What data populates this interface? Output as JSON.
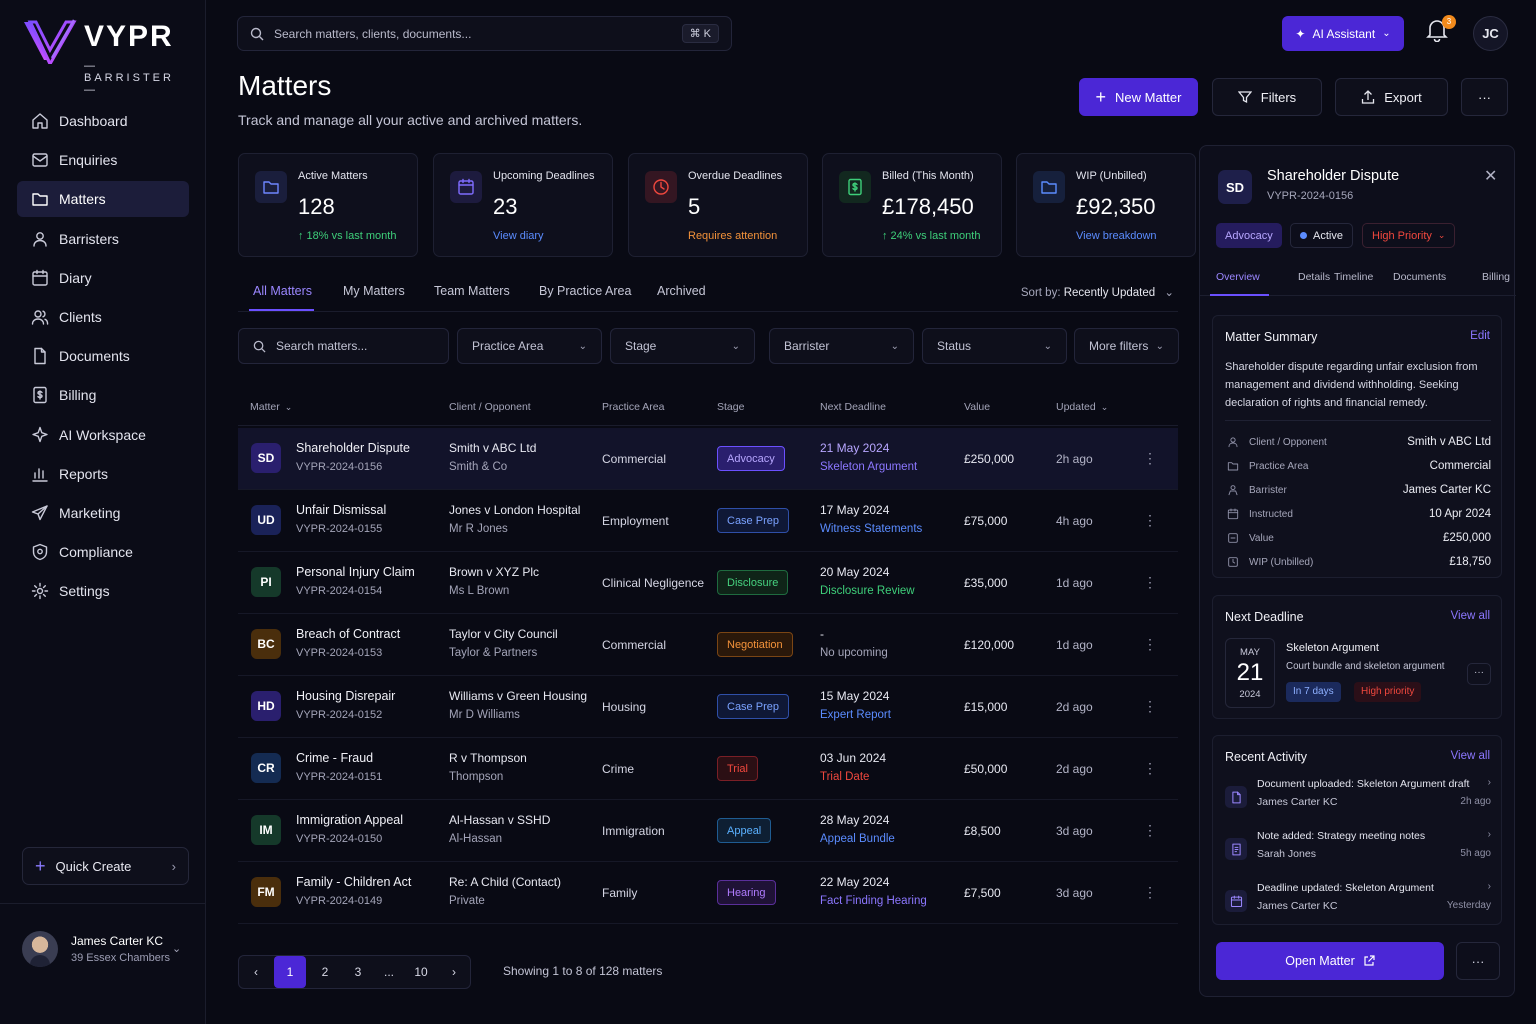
{
  "brand": {
    "name": "VYPR",
    "tagline": "BARRISTER"
  },
  "colors": {
    "accent": "#4b27d6",
    "accent_text": "#9b87ff",
    "success": "#3ecf7a",
    "danger": "#f0483e",
    "warning": "#f3923a",
    "link": "#5b8cff"
  },
  "sidebar": {
    "items": [
      {
        "label": "Dashboard",
        "icon": "home-icon"
      },
      {
        "label": "Enquiries",
        "icon": "mail-icon"
      },
      {
        "label": "Matters",
        "icon": "folder-icon",
        "active": true
      },
      {
        "label": "Barristers",
        "icon": "user-icon"
      },
      {
        "label": "Diary",
        "icon": "calendar-icon"
      },
      {
        "label": "Clients",
        "icon": "users-icon"
      },
      {
        "label": "Documents",
        "icon": "document-icon"
      },
      {
        "label": "Billing",
        "icon": "billing-icon"
      },
      {
        "label": "AI Workspace",
        "icon": "sparkle-icon"
      },
      {
        "label": "Reports",
        "icon": "bar-chart-icon"
      },
      {
        "label": "Marketing",
        "icon": "send-icon"
      },
      {
        "label": "Compliance",
        "icon": "shield-icon"
      },
      {
        "label": "Settings",
        "icon": "gear-icon"
      }
    ],
    "quick_create": "Quick Create",
    "user": {
      "name": "James Carter KC",
      "chambers": "39 Essex Chambers"
    }
  },
  "topbar": {
    "search_placeholder": "Search matters, clients, documents...",
    "shortcut": "⌘  K",
    "ai_label": "AI Assistant",
    "notifications": "3",
    "user_initials": "JC"
  },
  "header": {
    "title": "Matters",
    "subtitle": "Track and manage all your active and archived matters.",
    "new_label": "New Matter",
    "filters_label": "Filters",
    "export_label": "Export",
    "more_label": "···"
  },
  "stats": [
    {
      "label": "Active Matters",
      "value": "128",
      "sub": "↑ 18% vs last month",
      "sub_color": "#3ecf7a",
      "icon": "folder-icon",
      "icon_color": "#6e86ff",
      "icon_bg": "#1a1e3c"
    },
    {
      "label": "Upcoming Deadlines",
      "value": "23",
      "sub": "View diary",
      "sub_color": "#5b8cff",
      "icon": "calendar-icon",
      "icon_color": "#7f6cff",
      "icon_bg": "#1d1b3e"
    },
    {
      "label": "Overdue Deadlines",
      "value": "5",
      "sub": "Requires attention",
      "sub_color": "#f3923a",
      "icon": "clock-icon",
      "icon_color": "#f0483e",
      "icon_bg": "#341622"
    },
    {
      "label": "Billed (This Month)",
      "value": "£178,450",
      "sub": "↑ 24% vs last month",
      "sub_color": "#3ecf7a",
      "icon": "billing-icon",
      "icon_color": "#3ecf7a",
      "icon_bg": "#12281f"
    },
    {
      "label": "WIP (Unbilled)",
      "value": "£92,350",
      "sub": "View breakdown",
      "sub_color": "#5b8cff",
      "icon": "folder-icon",
      "icon_color": "#5b8cff",
      "icon_bg": "#16203c"
    }
  ],
  "tabs": [
    "All Matters",
    "My Matters",
    "Team Matters",
    "By Practice Area",
    "Archived"
  ],
  "sort": {
    "label": "Sort by:",
    "value": "Recently Updated"
  },
  "filters": {
    "search_placeholder": "Search matters...",
    "practice_area": "Practice Area",
    "stage": "Stage",
    "barrister": "Barrister",
    "status": "Status",
    "more": "More filters"
  },
  "table": {
    "columns": [
      "Matter",
      "Client / Opponent",
      "Practice Area",
      "Stage",
      "Next Deadline",
      "Value",
      "Updated"
    ],
    "rows": [
      {
        "initials": "SD",
        "av_bg": "#2a1f6e",
        "av_fg": "#ffffff",
        "name": "Shareholder Dispute",
        "ref": "VYPR-2024-0156",
        "client": "Smith v ABC Ltd",
        "opponent": "Smith & Co",
        "area": "Commercial",
        "stage": "Advocacy",
        "stage_color": "#b7a6ff",
        "stage_bg": "#2a1f6e",
        "stage_border": "#6b50ff",
        "deadline": "21 May 2024",
        "deadline_color": "#b7a6ff",
        "deadline_task": "Skeleton Argument",
        "task_color": "#8c77ff",
        "value": "£250,000",
        "updated": "2h ago",
        "selected": true
      },
      {
        "initials": "UD",
        "av_bg": "#1a2258",
        "av_fg": "#ffffff",
        "name": "Unfair Dismissal",
        "ref": "VYPR-2024-0155",
        "client": "Jones v London Hospital",
        "opponent": "Mr R Jones",
        "area": "Employment",
        "stage": "Case Prep",
        "stage_color": "#7aa2ff",
        "stage_bg": "#0f1836",
        "stage_border": "#2f4fa8",
        "deadline": "17 May 2024",
        "deadline_color": "#e8e9f2",
        "deadline_task": "Witness Statements",
        "task_color": "#5b8cff",
        "value": "£75,000",
        "updated": "4h ago"
      },
      {
        "initials": "PI",
        "av_bg": "#15392a",
        "av_fg": "#ffffff",
        "name": "Personal Injury Claim",
        "ref": "VYPR-2024-0154",
        "client": "Brown v XYZ Plc",
        "opponent": "Ms L Brown",
        "area": "Clinical Negligence",
        "stage": "Disclosure",
        "stage_color": "#46d27f",
        "stage_bg": "#0f2418",
        "stage_border": "#1f6b3f",
        "deadline": "20 May 2024",
        "deadline_color": "#e8e9f2",
        "deadline_task": "Disclosure Review",
        "task_color": "#3ecf7a",
        "value": "£35,000",
        "updated": "1d ago"
      },
      {
        "initials": "BC",
        "av_bg": "#4a2e0c",
        "av_fg": "#ffffff",
        "name": "Breach of Contract",
        "ref": "VYPR-2024-0153",
        "client": "Taylor v City Council",
        "opponent": "Taylor & Partners",
        "area": "Commercial",
        "stage": "Negotiation",
        "stage_color": "#f3923a",
        "stage_bg": "#2a180a",
        "stage_border": "#7a4514",
        "deadline": "-",
        "deadline_color": "#e8e9f2",
        "deadline_task": "No upcoming",
        "task_color": "#a4a5b9",
        "value": "£120,000",
        "updated": "1d ago"
      },
      {
        "initials": "HD",
        "av_bg": "#2a1f6e",
        "av_fg": "#ffffff",
        "name": "Housing Disrepair",
        "ref": "VYPR-2024-0152",
        "client": "Williams v Green Housing",
        "opponent": "Mr D Williams",
        "area": "Housing",
        "stage": "Case Prep",
        "stage_color": "#7aa2ff",
        "stage_bg": "#0f1836",
        "stage_border": "#2f4fa8",
        "deadline": "15 May 2024",
        "deadline_color": "#e8e9f2",
        "deadline_task": "Expert Report",
        "task_color": "#5b8cff",
        "value": "£15,000",
        "updated": "2d ago"
      },
      {
        "initials": "CR",
        "av_bg": "#142b52",
        "av_fg": "#ffffff",
        "name": "Crime - Fraud",
        "ref": "VYPR-2024-0151",
        "client": "R v Thompson",
        "opponent": "Thompson",
        "area": "Crime",
        "stage": "Trial",
        "stage_color": "#f0483e",
        "stage_bg": "#2b0f14",
        "stage_border": "#7a1f26",
        "deadline": "03 Jun 2024",
        "deadline_color": "#e8e9f2",
        "deadline_task": "Trial Date",
        "task_color": "#f0483e",
        "value": "£50,000",
        "updated": "2d ago"
      },
      {
        "initials": "IM",
        "av_bg": "#15392a",
        "av_fg": "#ffffff",
        "name": "Immigration Appeal",
        "ref": "VYPR-2024-0150",
        "client": "Al-Hassan v SSHD",
        "opponent": "Al-Hassan",
        "area": "Immigration",
        "stage": "Appeal",
        "stage_color": "#5bb1ff",
        "stage_bg": "#0e1f33",
        "stage_border": "#1f5c92",
        "deadline": "28 May 2024",
        "deadline_color": "#e8e9f2",
        "deadline_task": "Appeal Bundle",
        "task_color": "#5b8cff",
        "value": "£8,500",
        "updated": "3d ago"
      },
      {
        "initials": "FM",
        "av_bg": "#4a2e0c",
        "av_fg": "#ffffff",
        "name": "Family - Children Act",
        "ref": "VYPR-2024-0149",
        "client": "Re: A Child (Contact)",
        "opponent": "Private",
        "area": "Family",
        "stage": "Hearing",
        "stage_color": "#b07cff",
        "stage_bg": "#1f1236",
        "stage_border": "#5a2f9a",
        "deadline": "22 May 2024",
        "deadline_color": "#e8e9f2",
        "deadline_task": "Fact Finding Hearing",
        "task_color": "#8c77ff",
        "value": "£7,500",
        "updated": "3d ago"
      }
    ]
  },
  "pagination": {
    "prev": "‹",
    "pages": [
      "1",
      "2",
      "3",
      "...",
      "10"
    ],
    "next": "›",
    "showing": "Showing 1 to 8 of 128 matters"
  },
  "panel": {
    "initials": "SD",
    "title": "Shareholder Dispute",
    "ref": "VYPR-2024-0156",
    "stage_pill": "Advocacy",
    "status_pill": "Active",
    "priority_pill": "High Priority",
    "tabs": [
      "Overview",
      "Details",
      "Timeline",
      "Documents",
      "Billing"
    ],
    "summary": {
      "heading": "Matter Summary",
      "edit": "Edit",
      "text": "Shareholder dispute regarding unfair exclusion from management and dividend withholding. Seeking declaration of rights and financial remedy.",
      "fields": [
        {
          "k": "Client / Opponent",
          "v": "Smith v ABC Ltd",
          "icon": "user-icon"
        },
        {
          "k": "Practice Area",
          "v": "Commercial",
          "icon": "folder-icon"
        },
        {
          "k": "Barrister",
          "v": "James Carter KC",
          "icon": "barrister-icon"
        },
        {
          "k": "Instructed",
          "v": "10 Apr 2024",
          "icon": "calendar-icon"
        },
        {
          "k": "Value",
          "v": "£250,000",
          "icon": "value-icon"
        },
        {
          "k": "WIP (Unbilled)",
          "v": "£18,750",
          "icon": "wip-icon"
        }
      ]
    },
    "deadline": {
      "heading": "Next Deadline",
      "view_all": "View all",
      "month": "MAY",
      "day": "21",
      "year": "2024",
      "title": "Skeleton Argument",
      "desc": "Court bundle and skeleton argument",
      "due": "In 7 days",
      "priority": "High priority"
    },
    "activity": {
      "heading": "Recent Activity",
      "view_all": "View all",
      "items": [
        {
          "text": "Document uploaded: Skeleton Argument draft",
          "who": "James Carter KC",
          "when": "2h ago",
          "icon": "document-icon"
        },
        {
          "text": "Note added: Strategy meeting notes",
          "who": "Sarah Jones",
          "when": "5h ago",
          "icon": "note-icon"
        },
        {
          "text": "Deadline updated: Skeleton Argument",
          "who": "James Carter KC",
          "when": "Yesterday",
          "icon": "calendar-icon"
        }
      ]
    },
    "open_label": "Open Matter",
    "more_label": "···"
  }
}
